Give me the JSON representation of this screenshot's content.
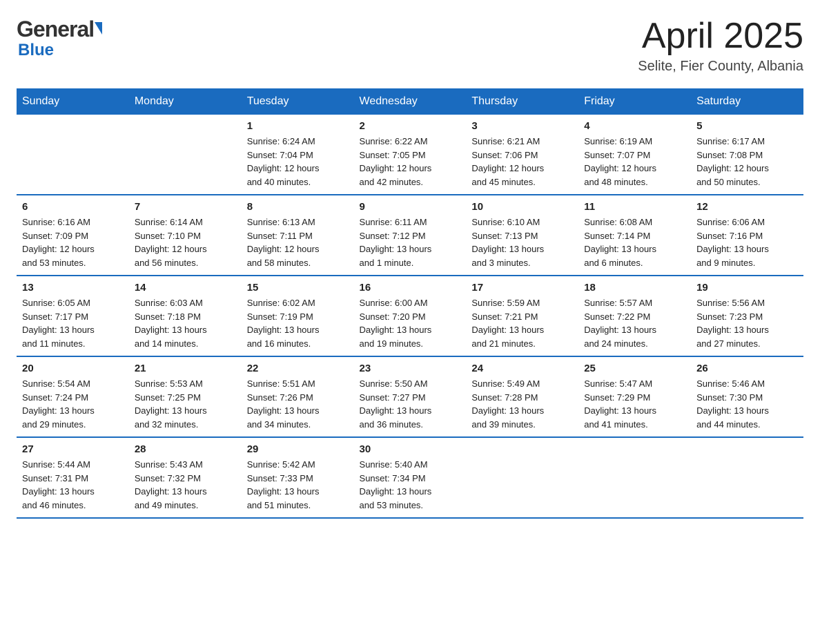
{
  "header": {
    "month_title": "April 2025",
    "location": "Selite, Fier County, Albania",
    "logo_general": "General",
    "logo_blue": "Blue"
  },
  "days_of_week": [
    "Sunday",
    "Monday",
    "Tuesday",
    "Wednesday",
    "Thursday",
    "Friday",
    "Saturday"
  ],
  "weeks": [
    [
      {
        "day": "",
        "info": ""
      },
      {
        "day": "",
        "info": ""
      },
      {
        "day": "1",
        "info": "Sunrise: 6:24 AM\nSunset: 7:04 PM\nDaylight: 12 hours\nand 40 minutes."
      },
      {
        "day": "2",
        "info": "Sunrise: 6:22 AM\nSunset: 7:05 PM\nDaylight: 12 hours\nand 42 minutes."
      },
      {
        "day": "3",
        "info": "Sunrise: 6:21 AM\nSunset: 7:06 PM\nDaylight: 12 hours\nand 45 minutes."
      },
      {
        "day": "4",
        "info": "Sunrise: 6:19 AM\nSunset: 7:07 PM\nDaylight: 12 hours\nand 48 minutes."
      },
      {
        "day": "5",
        "info": "Sunrise: 6:17 AM\nSunset: 7:08 PM\nDaylight: 12 hours\nand 50 minutes."
      }
    ],
    [
      {
        "day": "6",
        "info": "Sunrise: 6:16 AM\nSunset: 7:09 PM\nDaylight: 12 hours\nand 53 minutes."
      },
      {
        "day": "7",
        "info": "Sunrise: 6:14 AM\nSunset: 7:10 PM\nDaylight: 12 hours\nand 56 minutes."
      },
      {
        "day": "8",
        "info": "Sunrise: 6:13 AM\nSunset: 7:11 PM\nDaylight: 12 hours\nand 58 minutes."
      },
      {
        "day": "9",
        "info": "Sunrise: 6:11 AM\nSunset: 7:12 PM\nDaylight: 13 hours\nand 1 minute."
      },
      {
        "day": "10",
        "info": "Sunrise: 6:10 AM\nSunset: 7:13 PM\nDaylight: 13 hours\nand 3 minutes."
      },
      {
        "day": "11",
        "info": "Sunrise: 6:08 AM\nSunset: 7:14 PM\nDaylight: 13 hours\nand 6 minutes."
      },
      {
        "day": "12",
        "info": "Sunrise: 6:06 AM\nSunset: 7:16 PM\nDaylight: 13 hours\nand 9 minutes."
      }
    ],
    [
      {
        "day": "13",
        "info": "Sunrise: 6:05 AM\nSunset: 7:17 PM\nDaylight: 13 hours\nand 11 minutes."
      },
      {
        "day": "14",
        "info": "Sunrise: 6:03 AM\nSunset: 7:18 PM\nDaylight: 13 hours\nand 14 minutes."
      },
      {
        "day": "15",
        "info": "Sunrise: 6:02 AM\nSunset: 7:19 PM\nDaylight: 13 hours\nand 16 minutes."
      },
      {
        "day": "16",
        "info": "Sunrise: 6:00 AM\nSunset: 7:20 PM\nDaylight: 13 hours\nand 19 minutes."
      },
      {
        "day": "17",
        "info": "Sunrise: 5:59 AM\nSunset: 7:21 PM\nDaylight: 13 hours\nand 21 minutes."
      },
      {
        "day": "18",
        "info": "Sunrise: 5:57 AM\nSunset: 7:22 PM\nDaylight: 13 hours\nand 24 minutes."
      },
      {
        "day": "19",
        "info": "Sunrise: 5:56 AM\nSunset: 7:23 PM\nDaylight: 13 hours\nand 27 minutes."
      }
    ],
    [
      {
        "day": "20",
        "info": "Sunrise: 5:54 AM\nSunset: 7:24 PM\nDaylight: 13 hours\nand 29 minutes."
      },
      {
        "day": "21",
        "info": "Sunrise: 5:53 AM\nSunset: 7:25 PM\nDaylight: 13 hours\nand 32 minutes."
      },
      {
        "day": "22",
        "info": "Sunrise: 5:51 AM\nSunset: 7:26 PM\nDaylight: 13 hours\nand 34 minutes."
      },
      {
        "day": "23",
        "info": "Sunrise: 5:50 AM\nSunset: 7:27 PM\nDaylight: 13 hours\nand 36 minutes."
      },
      {
        "day": "24",
        "info": "Sunrise: 5:49 AM\nSunset: 7:28 PM\nDaylight: 13 hours\nand 39 minutes."
      },
      {
        "day": "25",
        "info": "Sunrise: 5:47 AM\nSunset: 7:29 PM\nDaylight: 13 hours\nand 41 minutes."
      },
      {
        "day": "26",
        "info": "Sunrise: 5:46 AM\nSunset: 7:30 PM\nDaylight: 13 hours\nand 44 minutes."
      }
    ],
    [
      {
        "day": "27",
        "info": "Sunrise: 5:44 AM\nSunset: 7:31 PM\nDaylight: 13 hours\nand 46 minutes."
      },
      {
        "day": "28",
        "info": "Sunrise: 5:43 AM\nSunset: 7:32 PM\nDaylight: 13 hours\nand 49 minutes."
      },
      {
        "day": "29",
        "info": "Sunrise: 5:42 AM\nSunset: 7:33 PM\nDaylight: 13 hours\nand 51 minutes."
      },
      {
        "day": "30",
        "info": "Sunrise: 5:40 AM\nSunset: 7:34 PM\nDaylight: 13 hours\nand 53 minutes."
      },
      {
        "day": "",
        "info": ""
      },
      {
        "day": "",
        "info": ""
      },
      {
        "day": "",
        "info": ""
      }
    ]
  ]
}
